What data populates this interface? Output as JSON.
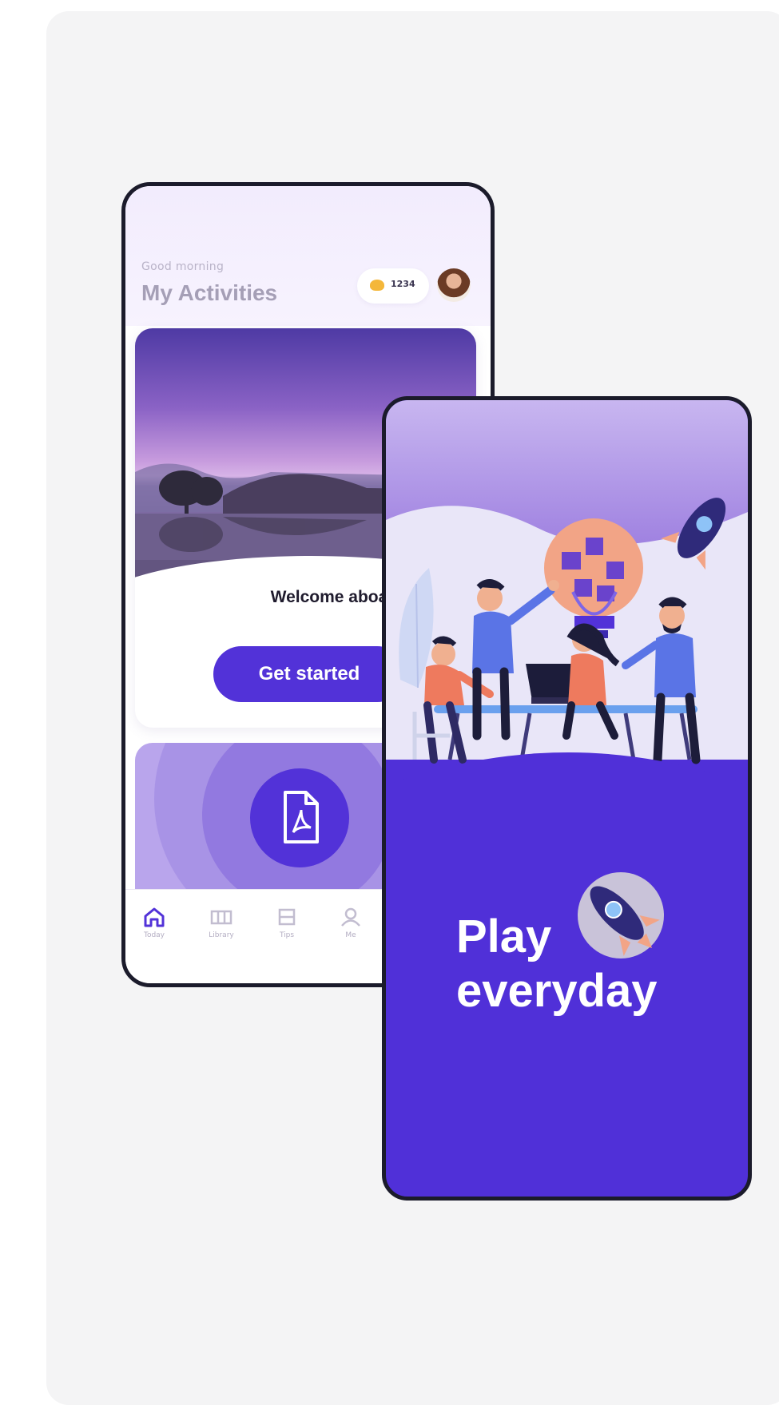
{
  "activities_screen": {
    "greeting": "Good morning",
    "title": "My Activities",
    "coin_count": "1234",
    "welcome_text": "Welcome aboard",
    "cta_label": "Get started",
    "tabs": [
      {
        "label": "Today"
      },
      {
        "label": "Library"
      },
      {
        "label": "Tips"
      },
      {
        "label": "Me"
      }
    ]
  },
  "promo_screen": {
    "headline_line1": "Play",
    "headline_line2": "everyday"
  },
  "colors": {
    "primary": "#5232d8",
    "header_bg": "#f2ecfd",
    "promo_bg": "#5030d8",
    "title_text": "#a59fb6",
    "frame": "#1b1b2b"
  },
  "icons": [
    "coin-icon",
    "avatar",
    "pdf-file-icon",
    "home-icon",
    "library-icon",
    "tips-icon",
    "rocket-icon",
    "lightbulb-puzzle-illustration"
  ]
}
